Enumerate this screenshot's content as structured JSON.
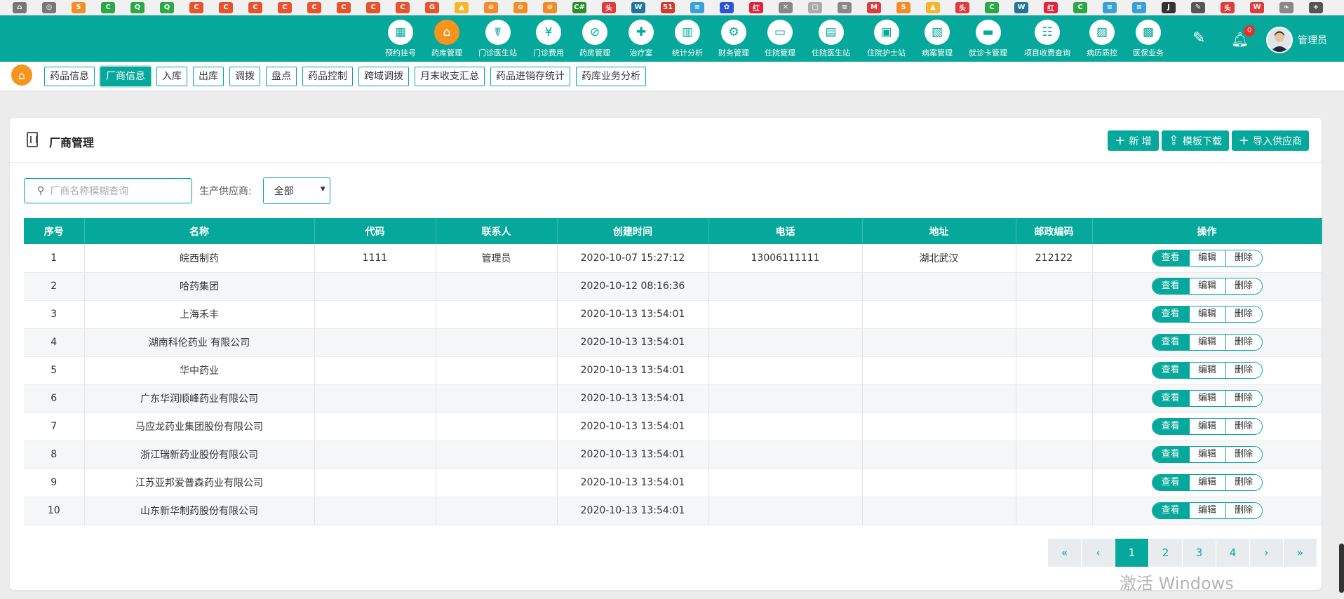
{
  "browser": {
    "favicons": [
      {
        "icon": "home-icon",
        "color": "#777777",
        "glyph": "⌂"
      },
      {
        "icon": "globe-icon",
        "color": "#777777",
        "glyph": "◎"
      },
      {
        "icon": "s-icon",
        "color": "#f28c28",
        "glyph": "S"
      },
      {
        "icon": "c-icon",
        "color": "#2aa845",
        "glyph": "C"
      },
      {
        "icon": "q-icon",
        "color": "#2aa845",
        "glyph": "Q"
      },
      {
        "icon": "q-icon",
        "color": "#2aa845",
        "glyph": "Q"
      },
      {
        "icon": "c-icon",
        "color": "#e8532b",
        "glyph": "C"
      },
      {
        "icon": "c-icon",
        "color": "#e8532b",
        "glyph": "C"
      },
      {
        "icon": "c-icon",
        "color": "#e8532b",
        "glyph": "C"
      },
      {
        "icon": "c-icon",
        "color": "#e8532b",
        "glyph": "C"
      },
      {
        "icon": "c-icon",
        "color": "#e8532b",
        "glyph": "C"
      },
      {
        "icon": "c-icon",
        "color": "#e8532b",
        "glyph": "C"
      },
      {
        "icon": "c-icon",
        "color": "#e8532b",
        "glyph": "C"
      },
      {
        "icon": "c-icon",
        "color": "#e8532b",
        "glyph": "C"
      },
      {
        "icon": "g-icon",
        "color": "#e8532b",
        "glyph": "G"
      },
      {
        "icon": "bell-icon",
        "color": "#f2b72b",
        "glyph": "▲"
      },
      {
        "icon": "code-icon",
        "color": "#f28c28",
        "glyph": "⊖"
      },
      {
        "icon": "code-icon",
        "color": "#f28c28",
        "glyph": "⊖"
      },
      {
        "icon": "code-icon",
        "color": "#f28c28",
        "glyph": "⊖"
      },
      {
        "icon": "csharp-icon",
        "color": "#2a8f2a",
        "glyph": "C#"
      },
      {
        "icon": "toutiao-icon",
        "color": "#e03a3a",
        "glyph": "头"
      },
      {
        "icon": "wordpress-icon",
        "color": "#21759b",
        "glyph": "W"
      },
      {
        "icon": "51-icon",
        "color": "#d33a2c",
        "glyph": "51"
      },
      {
        "icon": "stack-icon",
        "color": "#3aa0d8",
        "glyph": "≡"
      },
      {
        "icon": "paw-icon",
        "color": "#2a55d8",
        "glyph": "✿"
      },
      {
        "icon": "xiaohongshu-icon",
        "color": "#e0243a",
        "glyph": "红"
      },
      {
        "icon": "close-icon",
        "color": "#888888",
        "glyph": "✕"
      },
      {
        "icon": "doc-icon",
        "color": "#aaaaaa",
        "glyph": "▢"
      },
      {
        "icon": "doc-icon",
        "color": "#888888",
        "glyph": "≡"
      },
      {
        "icon": "m-icon",
        "color": "#e03a3a",
        "glyph": "M"
      },
      {
        "icon": "s-icon",
        "color": "#f28c28",
        "glyph": "S"
      },
      {
        "icon": "bell-icon",
        "color": "#f2b72b",
        "glyph": "▲"
      },
      {
        "icon": "toutiao-icon",
        "color": "#e03a3a",
        "glyph": "头"
      },
      {
        "icon": "c-icon",
        "color": "#2aa845",
        "glyph": "C"
      },
      {
        "icon": "wordpress-icon",
        "color": "#21759b",
        "glyph": "W"
      },
      {
        "icon": "xiaohongshu-icon",
        "color": "#e0243a",
        "glyph": "红"
      },
      {
        "icon": "c-icon",
        "color": "#2aa845",
        "glyph": "C"
      },
      {
        "icon": "stack-icon",
        "color": "#3aa0d8",
        "glyph": "≡"
      },
      {
        "icon": "stack-icon",
        "color": "#3aa0d8",
        "glyph": "≡"
      },
      {
        "icon": "js-icon",
        "color": "#333333",
        "glyph": "J"
      },
      {
        "icon": "pen-icon",
        "color": "#555555",
        "glyph": "✎"
      },
      {
        "icon": "toutiao-icon",
        "color": "#e03a3a",
        "glyph": "头"
      },
      {
        "icon": "w-icon",
        "color": "#e03a3a",
        "glyph": "W"
      },
      {
        "icon": "feather-icon",
        "color": "#888888",
        "glyph": "❧"
      },
      {
        "icon": "plus-icon",
        "color": "#555555",
        "glyph": "+"
      }
    ]
  },
  "header": {
    "nav": [
      {
        "label": "预约挂号",
        "icon": "calendar-icon",
        "glyph": "▦",
        "active": false,
        "size": ""
      },
      {
        "label": "药库管理",
        "icon": "home-gear-icon",
        "glyph": "⌂",
        "active": true,
        "size": ""
      },
      {
        "label": "门诊医生站",
        "icon": "doctor-icon",
        "glyph": "☤",
        "active": false,
        "size": "wide"
      },
      {
        "label": "门诊费用",
        "icon": "yen-icon",
        "glyph": "¥",
        "active": false,
        "size": ""
      },
      {
        "label": "药房管理",
        "icon": "pill-icon",
        "glyph": "⊘",
        "active": false,
        "size": ""
      },
      {
        "label": "治疗室",
        "icon": "nurse-icon",
        "glyph": "✚",
        "active": false,
        "size": ""
      },
      {
        "label": "统计分析",
        "icon": "chart-icon",
        "glyph": "▥",
        "active": false,
        "size": ""
      },
      {
        "label": "财务管理",
        "icon": "gear-icon",
        "glyph": "⚙",
        "active": false,
        "size": ""
      },
      {
        "label": "住院管理",
        "icon": "bed-icon",
        "glyph": "▭",
        "active": false,
        "size": ""
      },
      {
        "label": "住院医生站",
        "icon": "doctor-card-icon",
        "glyph": "▤",
        "active": false,
        "size": "wide"
      },
      {
        "label": "住院护士站",
        "icon": "nurse-card-icon",
        "glyph": "▣",
        "active": false,
        "size": "wide"
      },
      {
        "label": "病案管理",
        "icon": "record-icon",
        "glyph": "▧",
        "active": false,
        "size": ""
      },
      {
        "label": "就诊卡管理",
        "icon": "card-icon",
        "glyph": "▬",
        "active": false,
        "size": "wide"
      },
      {
        "label": "项目收费查询",
        "icon": "receipt-icon",
        "glyph": "☷",
        "active": false,
        "size": "wider"
      },
      {
        "label": "病历质控",
        "icon": "quality-icon",
        "glyph": "▨",
        "active": false,
        "size": ""
      },
      {
        "label": "医保业务",
        "icon": "insurance-icon",
        "glyph": "▩",
        "active": false,
        "size": ""
      }
    ],
    "notification_count": "0",
    "user_name": "管理员"
  },
  "subnav": {
    "tabs": [
      {
        "label": "药品信息",
        "active": false
      },
      {
        "label": "厂商信息",
        "active": true
      },
      {
        "label": "入库",
        "active": false
      },
      {
        "label": "出库",
        "active": false
      },
      {
        "label": "调拨",
        "active": false
      },
      {
        "label": "盘点",
        "active": false
      },
      {
        "label": "药品控制",
        "active": false
      },
      {
        "label": "跨域调拨",
        "active": false
      },
      {
        "label": "月末收支汇总",
        "active": false
      },
      {
        "label": "药品进销存统计",
        "active": false
      },
      {
        "label": "药库业务分析",
        "active": false
      }
    ]
  },
  "panel": {
    "title": "厂商管理",
    "buttons": [
      {
        "label": "新 增",
        "icon": "plus-icon",
        "glyph": "+"
      },
      {
        "label": "模板下载",
        "icon": "upload-icon",
        "glyph": "⇪"
      },
      {
        "label": "导入供应商",
        "icon": "plus-icon",
        "glyph": "+"
      }
    ],
    "search": {
      "placeholder": "厂商名称模糊查询",
      "value": ""
    },
    "filter_label": "生产供应商:",
    "filter_value": "全部"
  },
  "table": {
    "columns": [
      "序号",
      "名称",
      "代码",
      "联系人",
      "创建时间",
      "电话",
      "地址",
      "邮政编码",
      "操作"
    ],
    "rows": [
      {
        "no": "1",
        "name": "皖西制药",
        "code": "1111",
        "contact": "管理员",
        "created": "2020-10-07 15:27:12",
        "phone": "13006111111",
        "address": "湖北武汉",
        "zip": "212122"
      },
      {
        "no": "2",
        "name": "哈药集团",
        "code": "",
        "contact": "",
        "created": "2020-10-12 08:16:36",
        "phone": "",
        "address": "",
        "zip": ""
      },
      {
        "no": "3",
        "name": "上海禾丰",
        "code": "",
        "contact": "",
        "created": "2020-10-13 13:54:01",
        "phone": "",
        "address": "",
        "zip": ""
      },
      {
        "no": "4",
        "name": "湖南科伦药业 有限公司",
        "code": "",
        "contact": "",
        "created": "2020-10-13 13:54:01",
        "phone": "",
        "address": "",
        "zip": ""
      },
      {
        "no": "5",
        "name": "华中药业",
        "code": "",
        "contact": "",
        "created": "2020-10-13 13:54:01",
        "phone": "",
        "address": "",
        "zip": ""
      },
      {
        "no": "6",
        "name": "广东华润顺峰药业有限公司",
        "code": "",
        "contact": "",
        "created": "2020-10-13 13:54:01",
        "phone": "",
        "address": "",
        "zip": ""
      },
      {
        "no": "7",
        "name": "马应龙药业集团股份有限公司",
        "code": "",
        "contact": "",
        "created": "2020-10-13 13:54:01",
        "phone": "",
        "address": "",
        "zip": ""
      },
      {
        "no": "8",
        "name": "浙江瑞新药业股份有限公司",
        "code": "",
        "contact": "",
        "created": "2020-10-13 13:54:01",
        "phone": "",
        "address": "",
        "zip": ""
      },
      {
        "no": "9",
        "name": "江苏亚邦爱普森药业有限公司",
        "code": "",
        "contact": "",
        "created": "2020-10-13 13:54:01",
        "phone": "",
        "address": "",
        "zip": ""
      },
      {
        "no": "10",
        "name": "山东新华制药股份有限公司",
        "code": "",
        "contact": "",
        "created": "2020-10-13 13:54:01",
        "phone": "",
        "address": "",
        "zip": ""
      }
    ],
    "actions": {
      "view": "查看",
      "edit": "编辑",
      "delete": "删除"
    }
  },
  "pagination": {
    "items": [
      {
        "label": "«",
        "active": false
      },
      {
        "label": "‹",
        "active": false
      },
      {
        "label": "1",
        "active": true
      },
      {
        "label": "2",
        "active": false
      },
      {
        "label": "3",
        "active": false
      },
      {
        "label": "4",
        "active": false
      },
      {
        "label": "›",
        "active": false
      },
      {
        "label": "»",
        "active": false
      }
    ]
  },
  "watermark": "激活 Windows",
  "colors": {
    "primary": "#05a89b",
    "accent": "#f7941d",
    "badge": "#e92b2b"
  }
}
